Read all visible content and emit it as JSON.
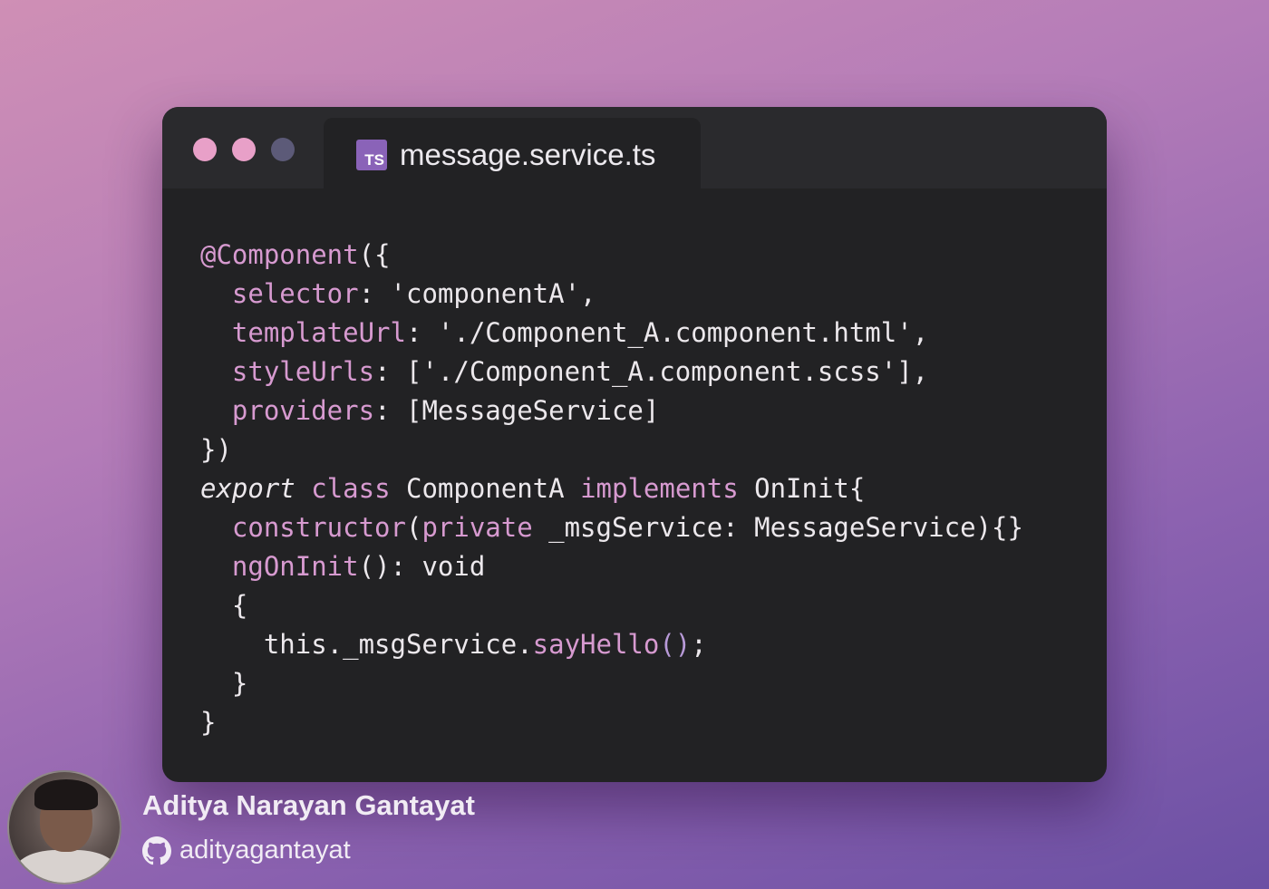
{
  "editor": {
    "tab": {
      "language_badge": "TS",
      "filename": "message.service.ts"
    },
    "code_lines": [
      [
        {
          "t": "@Component",
          "c": "pink"
        },
        {
          "t": "({",
          "c": ""
        }
      ],
      [
        {
          "t": "  ",
          "c": ""
        },
        {
          "t": "selector",
          "c": "pink"
        },
        {
          "t": ": 'componentA',",
          "c": ""
        }
      ],
      [
        {
          "t": "  ",
          "c": ""
        },
        {
          "t": "templateUrl",
          "c": "pink"
        },
        {
          "t": ": './Component_A.component.html',",
          "c": ""
        }
      ],
      [
        {
          "t": "  ",
          "c": ""
        },
        {
          "t": "styleUrls",
          "c": "pink"
        },
        {
          "t": ": ['./Component_A.component.scss'],",
          "c": ""
        }
      ],
      [
        {
          "t": "  ",
          "c": ""
        },
        {
          "t": "providers",
          "c": "pink"
        },
        {
          "t": ": [MessageService]",
          "c": ""
        }
      ],
      [
        {
          "t": "})",
          "c": ""
        }
      ],
      [
        {
          "t": "export",
          "c": "ital"
        },
        {
          "t": " ",
          "c": ""
        },
        {
          "t": "class",
          "c": "pink"
        },
        {
          "t": " ComponentA ",
          "c": ""
        },
        {
          "t": "implements",
          "c": "pink"
        },
        {
          "t": " OnInit{",
          "c": ""
        }
      ],
      [
        {
          "t": "  ",
          "c": ""
        },
        {
          "t": "constructor",
          "c": "pink"
        },
        {
          "t": "(",
          "c": ""
        },
        {
          "t": "private",
          "c": "pink"
        },
        {
          "t": " _msgService: MessageService){}",
          "c": ""
        }
      ],
      [
        {
          "t": "  ",
          "c": ""
        },
        {
          "t": "ngOnInit",
          "c": "pink"
        },
        {
          "t": "(): void",
          "c": ""
        }
      ],
      [
        {
          "t": "  {",
          "c": ""
        }
      ],
      [
        {
          "t": "    this._msgService.",
          "c": ""
        },
        {
          "t": "sayHello",
          "c": "pink"
        },
        {
          "t": "()",
          "c": "purple"
        },
        {
          "t": ";",
          "c": ""
        }
      ],
      [
        {
          "t": "  }",
          "c": ""
        }
      ],
      [
        {
          "t": "}",
          "c": ""
        }
      ]
    ]
  },
  "author": {
    "name": "Aditya Narayan Gantayat",
    "github_handle": "adityagantayat"
  },
  "colors": {
    "window_bg": "#222224",
    "titlebar_bg": "#2a2a2d",
    "keyword_pink": "#d79ad0",
    "paren_purple": "#b89ad8",
    "ts_badge": "#8a63b8"
  }
}
